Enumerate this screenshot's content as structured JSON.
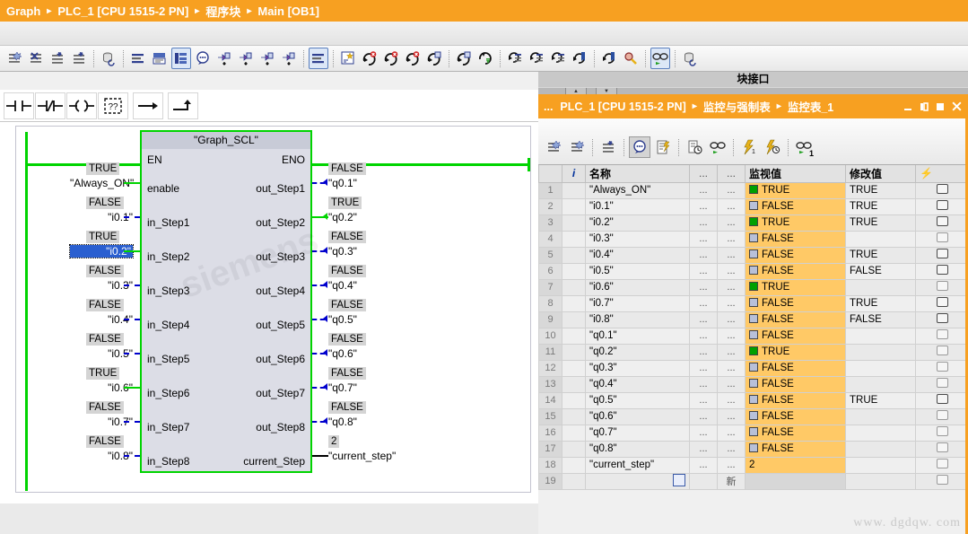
{
  "breadcrumb": {
    "items": [
      "Graph",
      "PLC_1 [CPU 1515-2 PN]",
      "程序块",
      "Main [OB1]"
    ],
    "separator": "▸"
  },
  "main_toolbar": {
    "icons": [
      "insert-network-icon",
      "delete-network-icon",
      "collapse-all-icon",
      "expand-all-icon",
      "absolute-relative-icon",
      "show-hide-operand-icon",
      "network-comment-icon",
      "show-comments-icon",
      "show-favorites-icon",
      "monitor-bookmark-icon",
      "download-monitor-icon",
      "watch-download-icon",
      "bookmark-download-icon",
      "layout-icon",
      "favorites-icon",
      "update-inconsistent-icon",
      "go-to-error-icon",
      "go-back-error-icon",
      "go-to-compile-icon",
      "go-back-compile-icon",
      "download-plc-icon",
      "goto-start-icon",
      "bookmark-set-icon",
      "bookmark-delete-icon",
      "prev-bookmark-icon",
      "next-bookmark-icon",
      "search-monitor-icon",
      "monitoring-on-icon",
      "protect-block-icon"
    ]
  },
  "lad_toolbar": {
    "buttons": [
      {
        "name": "normally-open-contact-icon",
        "label": "-| |-"
      },
      {
        "name": "normally-closed-contact-icon",
        "label": "-|/|-"
      },
      {
        "name": "output-coil-icon",
        "label": "-( )-"
      },
      {
        "name": "empty-box-icon",
        "label": "??"
      },
      {
        "name": "open-branch-icon",
        "label": "→"
      },
      {
        "name": "close-branch-icon",
        "label": "↱"
      }
    ]
  },
  "block_interface": {
    "label": "块接口"
  },
  "network": {
    "block_title": "\"Graph_SCL\"",
    "en_label": "EN",
    "eno_label": "ENO",
    "inputs": [
      {
        "pin": "enable",
        "value": "TRUE",
        "operand": "\"Always_ON\"",
        "state": "true",
        "selected": false
      },
      {
        "pin": "in_Step1",
        "value": "FALSE",
        "operand": "\"i0.1\"",
        "state": "false",
        "selected": false
      },
      {
        "pin": "in_Step2",
        "value": "TRUE",
        "operand": "\"i0.2\"",
        "state": "true",
        "selected": true
      },
      {
        "pin": "in_Step3",
        "value": "FALSE",
        "operand": "\"i0.3\"",
        "state": "false",
        "selected": false
      },
      {
        "pin": "in_Step4",
        "value": "FALSE",
        "operand": "\"i0.4\"",
        "state": "false",
        "selected": false
      },
      {
        "pin": "in_Step5",
        "value": "FALSE",
        "operand": "\"i0.5\"",
        "state": "false",
        "selected": false
      },
      {
        "pin": "in_Step6",
        "value": "TRUE",
        "operand": "\"i0.6\"",
        "state": "true",
        "selected": false
      },
      {
        "pin": "in_Step7",
        "value": "FALSE",
        "operand": "\"i0.7\"",
        "state": "false",
        "selected": false
      },
      {
        "pin": "in_Step8",
        "value": "FALSE",
        "operand": "\"i0.8\"",
        "state": "false",
        "selected": false
      }
    ],
    "outputs": [
      {
        "pin": "out_Step1",
        "value": "FALSE",
        "operand": "\"q0.1\"",
        "state": "false"
      },
      {
        "pin": "out_Step2",
        "value": "TRUE",
        "operand": "\"q0.2\"",
        "state": "true"
      },
      {
        "pin": "out_Step3",
        "value": "FALSE",
        "operand": "\"q0.3\"",
        "state": "false"
      },
      {
        "pin": "out_Step4",
        "value": "FALSE",
        "operand": "\"q0.4\"",
        "state": "false"
      },
      {
        "pin": "out_Step5",
        "value": "FALSE",
        "operand": "\"q0.5\"",
        "state": "false"
      },
      {
        "pin": "out_Step6",
        "value": "FALSE",
        "operand": "\"q0.6\"",
        "state": "false"
      },
      {
        "pin": "out_Step7",
        "value": "FALSE",
        "operand": "\"q0.7\"",
        "state": "false"
      },
      {
        "pin": "out_Step8",
        "value": "FALSE",
        "operand": "\"q0.8\"",
        "state": "false"
      },
      {
        "pin": "current_Step",
        "value": "2",
        "operand": "\"current_step\"",
        "state": "value"
      }
    ]
  },
  "watch_panel": {
    "title_prefix": "...",
    "title_items": [
      "PLC_1 [CPU 1515-2 PN]",
      "监控与强制表",
      "监控表_1"
    ],
    "separator": "▸",
    "window_buttons": [
      "minimize-icon",
      "restore-icon",
      "maximize-icon",
      "close-icon"
    ],
    "toolbar_icons": [
      "insert-row-icon",
      "insert-row-after-icon",
      "insert-rows-multi-icon",
      "expanded-mode-icon",
      "monitor-trigger-icon",
      "monitor-once-icon",
      "monitor-all-icon",
      "modify-now-icon",
      "enable-peripheral-icon",
      "force-monitor-icon"
    ],
    "columns": [
      "",
      "i",
      "名称",
      "...",
      "...",
      "监视值",
      "修改值",
      "⚡"
    ],
    "rows": [
      {
        "index": "1",
        "name": "\"Always_ON\"",
        "c1": "...",
        "c2": "...",
        "monitor": "TRUE",
        "state": "true",
        "modify": "TRUE",
        "check": true
      },
      {
        "index": "2",
        "name": "\"i0.1\"",
        "c1": "...",
        "c2": "...",
        "monitor": "FALSE",
        "state": "false",
        "modify": "TRUE",
        "check": true
      },
      {
        "index": "3",
        "name": "\"i0.2\"",
        "c1": "...",
        "c2": "...",
        "monitor": "TRUE",
        "state": "true",
        "modify": "TRUE",
        "check": true
      },
      {
        "index": "4",
        "name": "\"i0.3\"",
        "c1": "...",
        "c2": "...",
        "monitor": "FALSE",
        "state": "false",
        "modify": "",
        "check": true
      },
      {
        "index": "5",
        "name": "\"i0.4\"",
        "c1": "...",
        "c2": "...",
        "monitor": "FALSE",
        "state": "false",
        "modify": "TRUE",
        "check": true
      },
      {
        "index": "6",
        "name": "\"i0.5\"",
        "c1": "...",
        "c2": "...",
        "monitor": "FALSE",
        "state": "false",
        "modify": "FALSE",
        "check": true
      },
      {
        "index": "7",
        "name": "\"i0.6\"",
        "c1": "...",
        "c2": "...",
        "monitor": "TRUE",
        "state": "true",
        "modify": "",
        "check": true
      },
      {
        "index": "8",
        "name": "\"i0.7\"",
        "c1": "...",
        "c2": "...",
        "monitor": "FALSE",
        "state": "false",
        "modify": "TRUE",
        "check": true
      },
      {
        "index": "9",
        "name": "\"i0.8\"",
        "c1": "...",
        "c2": "...",
        "monitor": "FALSE",
        "state": "false",
        "modify": "FALSE",
        "check": true
      },
      {
        "index": "10",
        "name": "\"q0.1\"",
        "c1": "...",
        "c2": "...",
        "monitor": "FALSE",
        "state": "false",
        "modify": "",
        "check": true
      },
      {
        "index": "11",
        "name": "\"q0.2\"",
        "c1": "...",
        "c2": "...",
        "monitor": "TRUE",
        "state": "true",
        "modify": "",
        "check": true
      },
      {
        "index": "12",
        "name": "\"q0.3\"",
        "c1": "...",
        "c2": "...",
        "monitor": "FALSE",
        "state": "false",
        "modify": "",
        "check": true
      },
      {
        "index": "13",
        "name": "\"q0.4\"",
        "c1": "...",
        "c2": "...",
        "monitor": "FALSE",
        "state": "false",
        "modify": "",
        "check": true
      },
      {
        "index": "14",
        "name": "\"q0.5\"",
        "c1": "...",
        "c2": "...",
        "monitor": "FALSE",
        "state": "false",
        "modify": "TRUE",
        "check": true
      },
      {
        "index": "15",
        "name": "\"q0.6\"",
        "c1": "...",
        "c2": "...",
        "monitor": "FALSE",
        "state": "false",
        "modify": "",
        "check": true
      },
      {
        "index": "16",
        "name": "\"q0.7\"",
        "c1": "...",
        "c2": "...",
        "monitor": "FALSE",
        "state": "false",
        "modify": "",
        "check": true
      },
      {
        "index": "17",
        "name": "\"q0.8\"",
        "c1": "...",
        "c2": "...",
        "monitor": "FALSE",
        "state": "false",
        "modify": "",
        "check": true
      },
      {
        "index": "18",
        "name": "\"current_step\"",
        "c1": "...",
        "c2": "...",
        "monitor": "2",
        "state": "value",
        "modify": "",
        "check": true
      },
      {
        "index": "19",
        "name": "",
        "c1": "",
        "c2": "新",
        "monitor": "",
        "state": "empty",
        "modify": "",
        "check": true
      }
    ]
  },
  "watermark": {
    "text": "www. dgdqw. com",
    "overlay": "siemens.com 技术支持"
  },
  "colors": {
    "accent": "#f7a021",
    "true_green": "#00d400",
    "false_blue": "#0000cd",
    "monitor_bg": "#ffc966",
    "block_fill": "#dcdde6",
    "selection_blue": "#2a5fd0"
  }
}
